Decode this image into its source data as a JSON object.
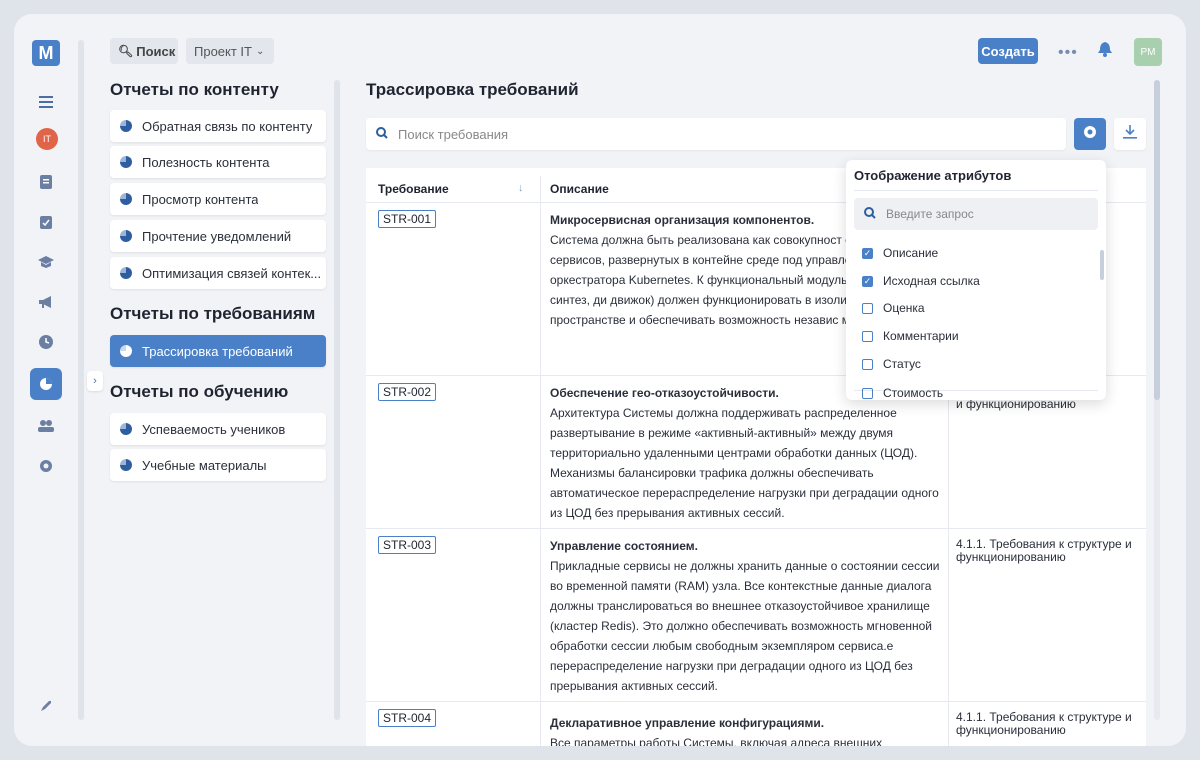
{
  "topbar": {
    "search_label": "Поиск",
    "project_label": "Проект IT",
    "create_label": "Создать",
    "more_label": "•••",
    "avatar_initials": "PM"
  },
  "rail": {
    "logo": "M",
    "project_avatar": "IT",
    "icons": [
      "menu-icon",
      "document-icon",
      "clipboard-icon",
      "graduation-icon",
      "megaphone-icon",
      "clock-icon",
      "pie-chart-icon",
      "users-icon",
      "gear-icon",
      "rocket-icon"
    ]
  },
  "reports": {
    "content_title": "Отчеты по контенту",
    "content_items": [
      "Обратная связь по контенту",
      "Полезность контента",
      "Просмотр контента",
      "Прочтение уведомлений",
      "Оптимизация связей контек..."
    ],
    "requirements_title": "Отчеты по требованиям",
    "requirements_items": [
      "Трассировка требований"
    ],
    "learning_title": "Отчеты по обучению",
    "learning_items": [
      "Успеваемость учеников",
      "Учебные материалы"
    ]
  },
  "main": {
    "title": "Трассировка требований",
    "search_placeholder": "Поиск требования",
    "col_requirement": "Требование",
    "col_description": "Описание",
    "rows": [
      {
        "id": "STR-001",
        "title": "Микросервисная организация компонентов.",
        "body": "Система должна быть реализована как совокупност слабосвязанных сервисов, развернутых в контейне среде под управлением оркестратора Kubernetes. К функциональный модуль (распознавание, синтез, ди движок) должен функционировать в изолированно пространстве и обеспечивать возможность независ масштабирования.",
        "ref": "уре"
      },
      {
        "id": "STR-002",
        "title": "Обеспечение гео-отказоустойчивости.",
        "body": "Архитектура Системы должна поддерживать распределенное развертывание в режиме «активный-активный» между двумя территориально удаленными центрами обработки данных (ЦОД). Механизмы балансировки трафика должны обеспечивать автоматическое перераспределение нагрузки при деградации одного из ЦОД без прерывания активных сессий.",
        "ref": "уре\nи функционированию"
      },
      {
        "id": "STR-003",
        "title": "Управление состоянием.",
        "body": "Прикладные сервисы не должны хранить данные о состоянии сессии во временной памяти (RAM) узла. Все контекстные данные диалога должны транслироваться во внешнее отказоустойчивое хранилище (кластер Redis). Это должно обеспечивать возможность мгновенной обработки сессии любым свободным экземпляром сервиса.е перераспределение нагрузки при деградации одного из ЦОД без прерывания активных сессий.",
        "ref": "4.1.1. Требования к структуре и функционированию"
      },
      {
        "id": "STR-004",
        "title": "Декларативное управление конфигурациями.",
        "body": "Все параметры работы Системы, включая адреса внешних",
        "ref": "4.1.1. Требования к структуре и функционированию"
      }
    ]
  },
  "popover": {
    "title": "Отображение атрибутов",
    "search_placeholder": "Введите запрос",
    "options": [
      {
        "label": "Описание",
        "checked": true
      },
      {
        "label": "Исходная ссылка",
        "checked": true
      },
      {
        "label": "Оценка",
        "checked": false
      },
      {
        "label": "Комментарии",
        "checked": false
      },
      {
        "label": "Статус",
        "checked": false
      },
      {
        "label": "Стоимость",
        "checked": false
      }
    ]
  },
  "colors": {
    "accent": "#4a80c8",
    "bg": "#f1f3f7",
    "avatar_it": "#e06447",
    "avatar_pm": "#a8cfae"
  }
}
